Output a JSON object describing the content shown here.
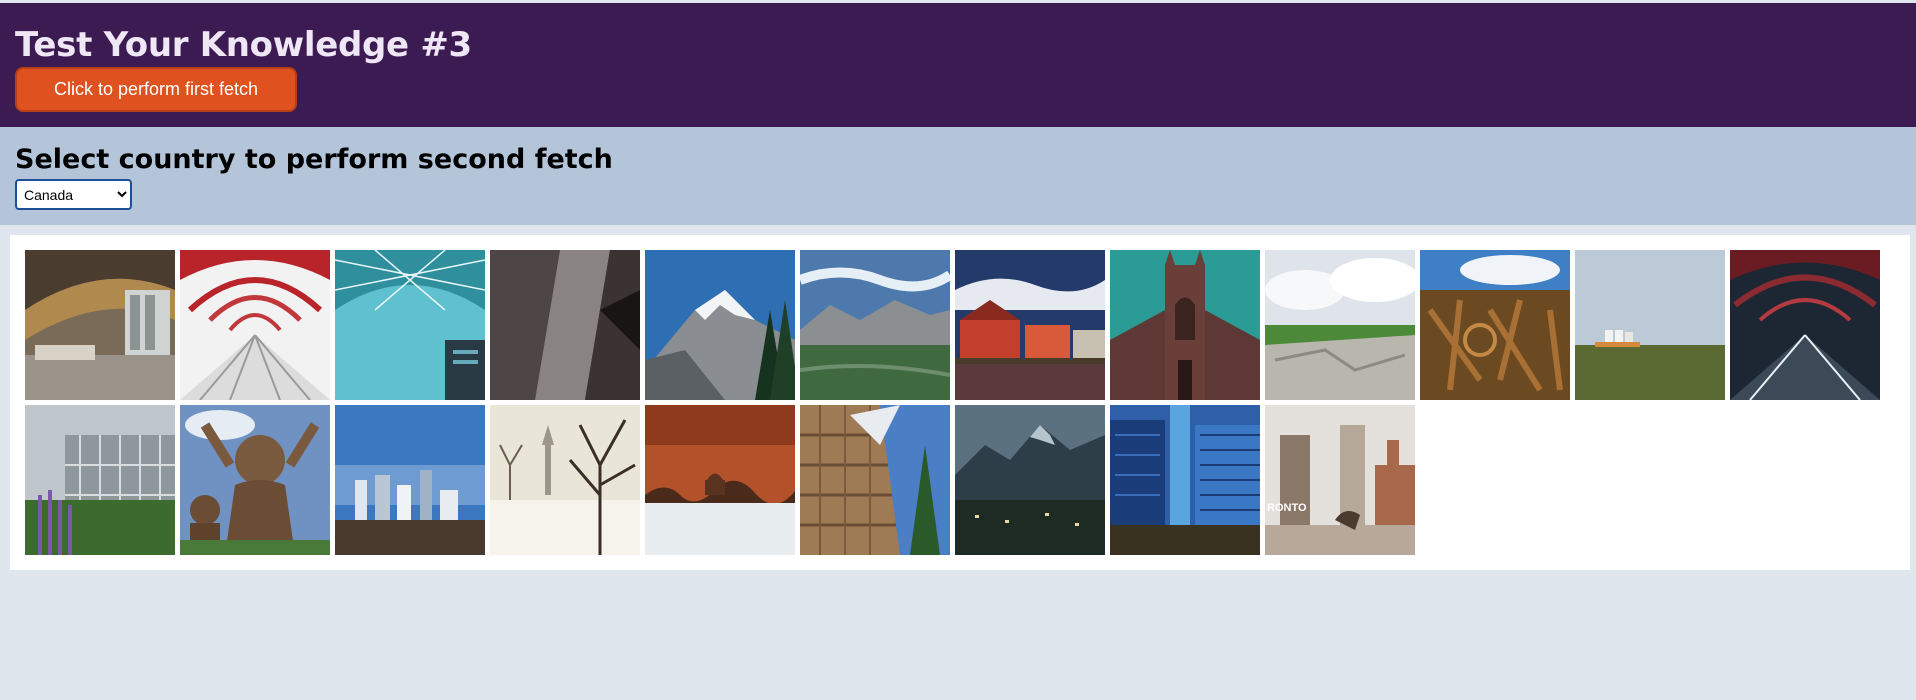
{
  "header": {
    "title": "Test Your Knowledge #3",
    "fetch_button_label": "Click to perform first fetch"
  },
  "selector": {
    "heading": "Select country to perform second fetch",
    "selected_country": "Canada"
  },
  "gallery": {
    "images": [
      "architecture-interior",
      "red-arch-bridge",
      "glass-dome-sky",
      "dark-metal-building",
      "snowy-mountain",
      "mountain-valley",
      "red-harbour-houses",
      "stone-church",
      "rocky-coast-clouds",
      "rusty-scrap",
      "prairie-horizon",
      "bridge-at-night",
      "glass-building-garden",
      "laughing-statues",
      "city-skyline",
      "snowy-park-trees",
      "sepia-snow-field",
      "stone-tower",
      "mountain-town",
      "blue-skyscrapers",
      "city-hall-square"
    ],
    "toronto_sign_text": "RONTO"
  }
}
